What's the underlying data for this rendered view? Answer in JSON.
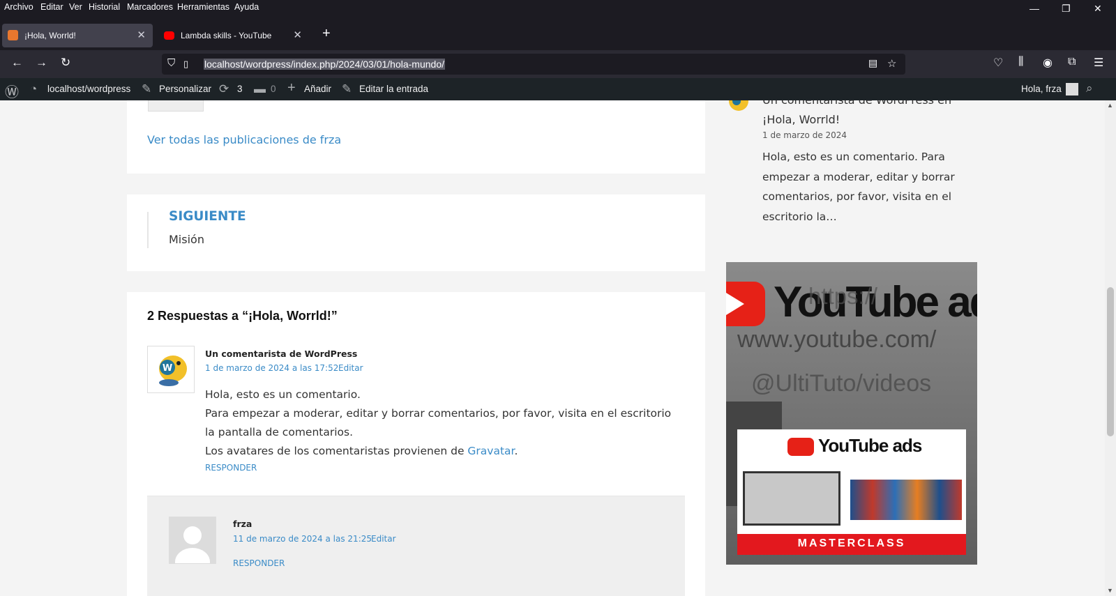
{
  "menu": [
    "Archivo",
    "Editar",
    "Ver",
    "Historial",
    "Marcadores",
    "Herramientas",
    "Ayuda"
  ],
  "window_controls": {
    "minimize": "—",
    "restore": "❐",
    "close": "✕"
  },
  "tabs": [
    {
      "title": "¡Hola, Worrld!",
      "active": true,
      "favicon_color": "#e8772e"
    },
    {
      "title": "Lambda skills - YouTube",
      "active": false,
      "favicon_color": "#ff0000"
    }
  ],
  "new_tab_label": "+",
  "url": "localhost/wordpress/index.php/2024/03/01/hola-mundo/",
  "adminbar": {
    "site": "localhost/wordpress",
    "customize": "Personalizar",
    "updates": "3",
    "comments": "0",
    "new": "Añadir",
    "edit": "Editar la entrada",
    "greeting": "Hola, frza"
  },
  "author_box": {
    "view_all": "Ver todas las publicaciones de frza"
  },
  "post_nav": {
    "label": "SIGUIENTE",
    "title": "Misión"
  },
  "comments": {
    "title": "2 Respuestas a “¡Hola, Worrld!”",
    "items": [
      {
        "author": "Un comentarista de WordPress",
        "date": "1 de marzo de 2024 a las 17:52",
        "edit": "Editar",
        "text_lines": [
          "Hola, esto es un comentario.",
          "Para empezar a moderar, editar y borrar comentarios, por favor, visita en el escritorio la pantalla de comentarios."
        ],
        "gravatar_prefix": "Los avatares de los comentaristas provienen de ",
        "gravatar_link": "Gravatar",
        "gravatar_suffix": ".",
        "reply": "RESPONDER"
      },
      {
        "author": "frza",
        "date": "11 de marzo de 2024 a las 21:25",
        "edit": "Editar",
        "reply": "RESPONDER"
      }
    ]
  },
  "sidebar": {
    "recent_comment_title": "Un comentarista de WordPress en ¡Hola, Worrld!",
    "recent_comment_date": "1 de marzo de 2024",
    "recent_comment_excerpt": "Hola, esto es un comentario. Para empezar a moderar, editar y borrar comentarios, por favor, visita en el escritorio la…",
    "ad": {
      "brand": "YouTube ads",
      "overlay_line1": "https://",
      "overlay_line2": "www.youtube.com/",
      "overlay_line3": "@UltiTuto/videos",
      "inner_brand": "YouTube ads",
      "banner": "MASTERCLASS"
    }
  },
  "colors": {
    "link": "#3a8bc7",
    "adminbar": "#1d2327",
    "chrome": "#1c1b22",
    "youtube_red": "#ff0000"
  }
}
